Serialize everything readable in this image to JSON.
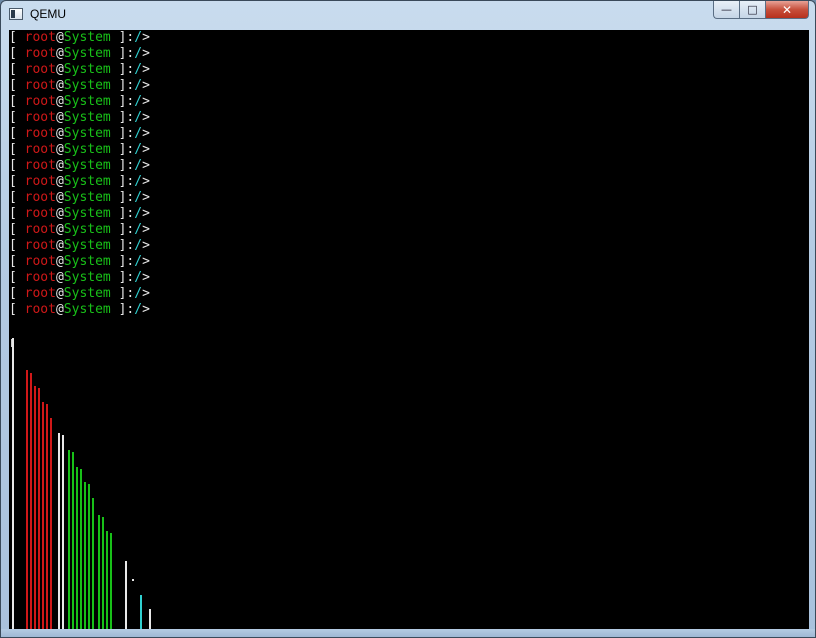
{
  "window": {
    "title": "QEMU",
    "controls": {
      "minimize_glyph": "—",
      "maximize_glyph": "□",
      "close_glyph": "✕"
    }
  },
  "terminal": {
    "prompt": {
      "open_bracket": "[ ",
      "user": "root",
      "at": "@",
      "host": "System",
      "close": " ]:",
      "path": "/",
      "arrow": ">"
    },
    "repeat_count": 18
  },
  "colors": {
    "terminal_bg": "#000000",
    "red": "#d01818",
    "green": "#18c018",
    "white": "#e8e8e8",
    "cyan": "#30d0d0"
  }
}
